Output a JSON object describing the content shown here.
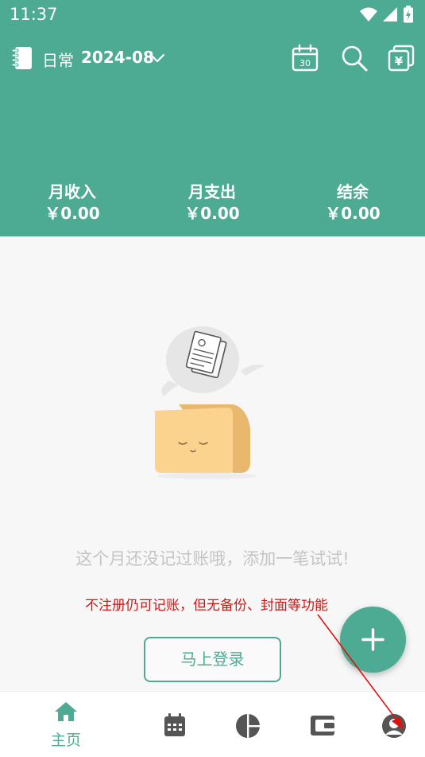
{
  "status_bar": {
    "time": "11:37"
  },
  "toolbar": {
    "ledger_name": "日常",
    "month": "2024-08",
    "calendar_badge": "30",
    "icons": [
      "ledger-book-icon",
      "chevron-down-icon",
      "calendar-icon",
      "search-icon",
      "currency-cards-icon"
    ]
  },
  "summary": {
    "income": {
      "label": "月收入",
      "value": "￥0.00"
    },
    "expense": {
      "label": "月支出",
      "value": "￥0.00"
    },
    "balance": {
      "label": "结余",
      "value": "￥0.00"
    }
  },
  "empty_state": {
    "message": "这个月还没记过账哦，添加一笔试试!"
  },
  "annotation": {
    "text": "不注册仍可记账，但无备份、封面等功能",
    "color": "#d01515"
  },
  "login_button": {
    "label": "马上登录"
  },
  "bottom_nav": {
    "home_label": "主页",
    "items": [
      "home-icon",
      "calendar-icon",
      "chart-icon",
      "wallet-icon",
      "profile-icon"
    ]
  },
  "colors": {
    "primary": "#4dab94",
    "background": "#f7f7f7",
    "empty_text": "#c4c4c4"
  }
}
